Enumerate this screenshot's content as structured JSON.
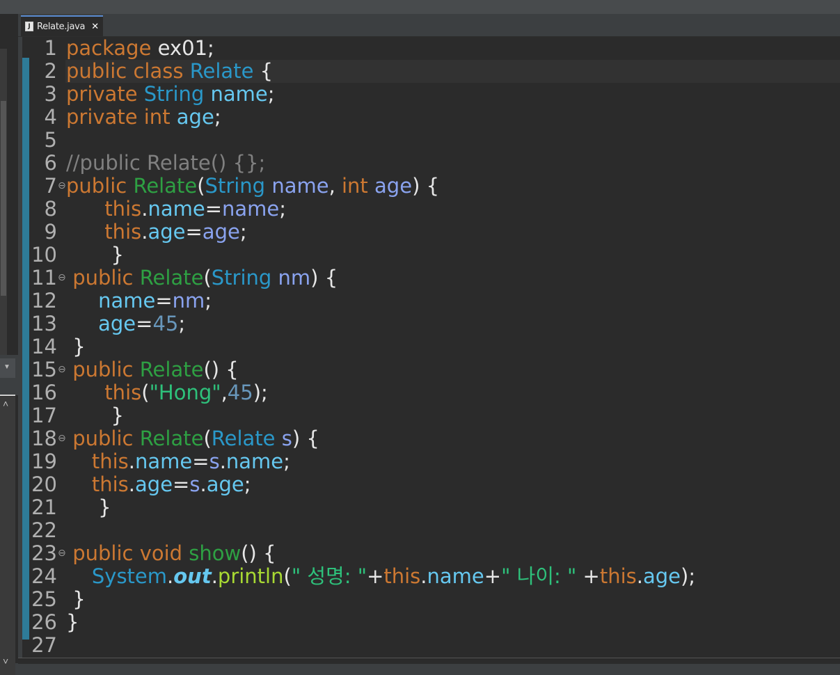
{
  "tab": {
    "icon": "java-file-icon",
    "label": "Relate.java",
    "close": "✕"
  },
  "colors": {
    "keyword": "#cc7832",
    "type": "#2a98c9",
    "field": "#66c8f0",
    "param": "#8aa3ef",
    "comment": "#808080",
    "method": "#2ea043",
    "string": "#2ec17b",
    "number": "#6897bb",
    "text": "#e6e6e6",
    "println": "#a8d933",
    "background": "#2b2b2b",
    "change_bar": "#2e7b98"
  },
  "lines": [
    {
      "n": "1",
      "fold": "",
      "tokens": [
        [
          "kw",
          "package"
        ],
        [
          "pl",
          " ex01;"
        ]
      ]
    },
    {
      "n": "2",
      "fold": "",
      "tokens": [
        [
          "kw",
          "public class "
        ],
        [
          "ty",
          "Relate"
        ],
        [
          "pl",
          " {"
        ]
      ]
    },
    {
      "n": "3",
      "fold": "",
      "tokens": [
        [
          "kw",
          "private "
        ],
        [
          "ty",
          "String "
        ],
        [
          "fld",
          "name"
        ],
        [
          "pl",
          ";"
        ]
      ]
    },
    {
      "n": "4",
      "fold": "",
      "tokens": [
        [
          "kw",
          "private int "
        ],
        [
          "fld",
          "age"
        ],
        [
          "pl",
          ";"
        ]
      ]
    },
    {
      "n": "5",
      "fold": "",
      "tokens": []
    },
    {
      "n": "6",
      "fold": "",
      "tokens": [
        [
          "cmt",
          "//public Relate() {};"
        ]
      ]
    },
    {
      "n": "7",
      "fold": "⊖",
      "tokens": [
        [
          "kw",
          "public "
        ],
        [
          "mth",
          "Relate"
        ],
        [
          "pl",
          "("
        ],
        [
          "ty",
          "String "
        ],
        [
          "par",
          "name"
        ],
        [
          "pl",
          ", "
        ],
        [
          "kw",
          "int "
        ],
        [
          "par",
          "age"
        ],
        [
          "pl",
          ") {"
        ]
      ]
    },
    {
      "n": "8",
      "fold": "",
      "tokens": [
        [
          "pl",
          "      "
        ],
        [
          "kw",
          "this"
        ],
        [
          "pl",
          "."
        ],
        [
          "fld",
          "name"
        ],
        [
          "pl",
          "="
        ],
        [
          "par",
          "name"
        ],
        [
          "pl",
          ";"
        ]
      ]
    },
    {
      "n": "9",
      "fold": "",
      "tokens": [
        [
          "pl",
          "      "
        ],
        [
          "kw",
          "this"
        ],
        [
          "pl",
          "."
        ],
        [
          "fld",
          "age"
        ],
        [
          "pl",
          "="
        ],
        [
          "par",
          "age"
        ],
        [
          "pl",
          ";"
        ]
      ]
    },
    {
      "n": "10",
      "fold": "",
      "tokens": [
        [
          "pl",
          "       }"
        ]
      ]
    },
    {
      "n": "11",
      "fold": "⊖",
      "tokens": [
        [
          "pl",
          " "
        ],
        [
          "kw",
          "public "
        ],
        [
          "mth",
          "Relate"
        ],
        [
          "pl",
          "("
        ],
        [
          "ty",
          "String "
        ],
        [
          "par",
          "nm"
        ],
        [
          "pl",
          ") {"
        ]
      ]
    },
    {
      "n": "12",
      "fold": "",
      "tokens": [
        [
          "pl",
          "     "
        ],
        [
          "fld",
          "name"
        ],
        [
          "pl",
          "="
        ],
        [
          "par",
          "nm"
        ],
        [
          "pl",
          ";"
        ]
      ]
    },
    {
      "n": "13",
      "fold": "",
      "tokens": [
        [
          "pl",
          "     "
        ],
        [
          "fld",
          "age"
        ],
        [
          "pl",
          "="
        ],
        [
          "num",
          "45"
        ],
        [
          "pl",
          ";"
        ]
      ]
    },
    {
      "n": "14",
      "fold": "",
      "tokens": [
        [
          "pl",
          " }"
        ]
      ]
    },
    {
      "n": "15",
      "fold": "⊖",
      "tokens": [
        [
          "pl",
          " "
        ],
        [
          "kw",
          "public "
        ],
        [
          "mth",
          "Relate"
        ],
        [
          "pl",
          "() {"
        ]
      ]
    },
    {
      "n": "16",
      "fold": "",
      "tokens": [
        [
          "pl",
          "      "
        ],
        [
          "kw",
          "this"
        ],
        [
          "pl",
          "("
        ],
        [
          "str",
          "\"Hong\""
        ],
        [
          "pl",
          ","
        ],
        [
          "num",
          "45"
        ],
        [
          "pl",
          ");"
        ]
      ]
    },
    {
      "n": "17",
      "fold": "",
      "tokens": [
        [
          "pl",
          "       }"
        ]
      ]
    },
    {
      "n": "18",
      "fold": "⊖",
      "tokens": [
        [
          "pl",
          " "
        ],
        [
          "kw",
          "public "
        ],
        [
          "mth",
          "Relate"
        ],
        [
          "pl",
          "("
        ],
        [
          "ty",
          "Relate "
        ],
        [
          "par",
          "s"
        ],
        [
          "pl",
          ") {"
        ]
      ]
    },
    {
      "n": "19",
      "fold": "",
      "tokens": [
        [
          "pl",
          "    "
        ],
        [
          "kw",
          "this"
        ],
        [
          "pl",
          "."
        ],
        [
          "fld",
          "name"
        ],
        [
          "pl",
          "="
        ],
        [
          "par",
          "s"
        ],
        [
          "pl",
          "."
        ],
        [
          "fld",
          "name"
        ],
        [
          "pl",
          ";"
        ]
      ]
    },
    {
      "n": "20",
      "fold": "",
      "tokens": [
        [
          "pl",
          "    "
        ],
        [
          "kw",
          "this"
        ],
        [
          "pl",
          "."
        ],
        [
          "fld",
          "age"
        ],
        [
          "pl",
          "="
        ],
        [
          "par",
          "s"
        ],
        [
          "pl",
          "."
        ],
        [
          "fld",
          "age"
        ],
        [
          "pl",
          ";"
        ]
      ]
    },
    {
      "n": "21",
      "fold": "",
      "tokens": [
        [
          "pl",
          "     }"
        ]
      ]
    },
    {
      "n": "22",
      "fold": "",
      "tokens": []
    },
    {
      "n": "23",
      "fold": "⊖",
      "tokens": [
        [
          "pl",
          " "
        ],
        [
          "kw",
          "public void "
        ],
        [
          "mth",
          "show"
        ],
        [
          "pl",
          "() {"
        ]
      ]
    },
    {
      "n": "24",
      "fold": "",
      "tokens": [
        [
          "pl",
          "    "
        ],
        [
          "sys",
          "System"
        ],
        [
          "pl",
          "."
        ],
        [
          "stat",
          "out"
        ],
        [
          "pl",
          "."
        ],
        [
          "prn",
          "println"
        ],
        [
          "pl",
          "("
        ],
        [
          "str",
          "\" 성명: \""
        ],
        [
          "pl",
          "+"
        ],
        [
          "kw",
          "this"
        ],
        [
          "pl",
          "."
        ],
        [
          "fld",
          "name"
        ],
        [
          "pl",
          "+"
        ],
        [
          "str",
          "\" 나이: \""
        ],
        [
          "pl",
          " +"
        ],
        [
          "kw",
          "this"
        ],
        [
          "pl",
          "."
        ],
        [
          "fld",
          "age"
        ],
        [
          "pl",
          ");"
        ]
      ]
    },
    {
      "n": "25",
      "fold": "",
      "tokens": [
        [
          "pl",
          " }"
        ]
      ]
    },
    {
      "n": "26",
      "fold": "",
      "tokens": [
        [
          "pl",
          "}"
        ]
      ]
    },
    {
      "n": "27",
      "fold": "",
      "tokens": []
    }
  ]
}
